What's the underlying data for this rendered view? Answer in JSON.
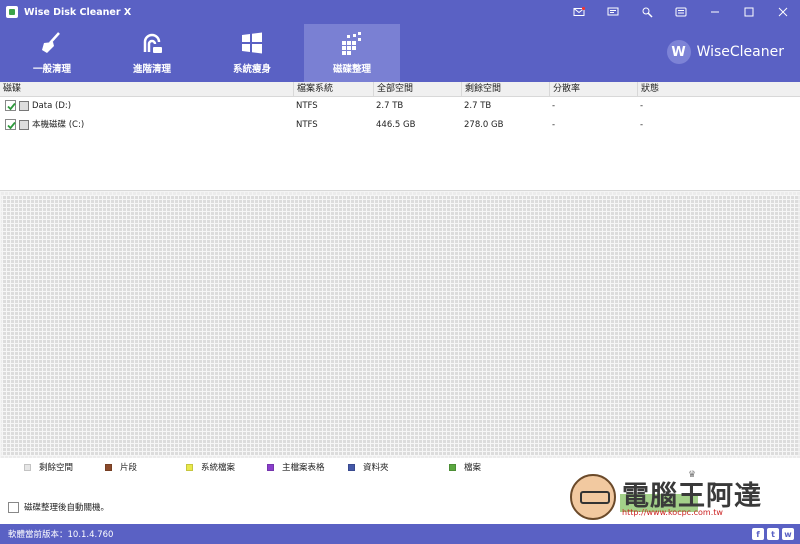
{
  "window": {
    "title": "Wise Disk Cleaner X"
  },
  "toolbar": {
    "tabs": [
      {
        "label": "一般清理",
        "icon": "broom-icon"
      },
      {
        "label": "進階清理",
        "icon": "deep-clean-icon"
      },
      {
        "label": "系統瘦身",
        "icon": "windows-icon"
      },
      {
        "label": "磁碟整理",
        "icon": "defrag-icon",
        "active": true
      }
    ],
    "brand": {
      "logo": "W",
      "name": "WiseCleaner"
    }
  },
  "table": {
    "headers": [
      "磁碟",
      "檔案系統",
      "全部空間",
      "剩餘空間",
      "分散率",
      "狀態"
    ],
    "rows": [
      {
        "name": "Data (D:)",
        "fs": "NTFS",
        "total": "2.7 TB",
        "free": "2.7 TB",
        "frag": "-",
        "status": "-",
        "checked": true
      },
      {
        "name": "本機磁碟 (C:)",
        "fs": "NTFS",
        "total": "446.5 GB",
        "free": "278.0 GB",
        "frag": "-",
        "status": "-",
        "checked": true
      }
    ]
  },
  "legend": [
    {
      "label": "剩餘空間",
      "color": "#e6e6e6"
    },
    {
      "label": "片段",
      "color": "#8b4a2b"
    },
    {
      "label": "系統檔案",
      "color": "#e9e94a"
    },
    {
      "label": "主檔案表格",
      "color": "#8a3fcc"
    },
    {
      "label": "資料夾",
      "color": "#4458a8"
    },
    {
      "label": "檔案",
      "color": "#5aa73f"
    }
  ],
  "options": {
    "auto_shutdown": "磁碟整理後自動關機。"
  },
  "watermark": {
    "text": "電腦王阿達",
    "url": "http://www.kocpc.com.tw"
  },
  "status": {
    "version": "軟體當前版本：10.1.4.760"
  },
  "social": {
    "facebook": "f",
    "twitter": "t",
    "more": "w"
  }
}
